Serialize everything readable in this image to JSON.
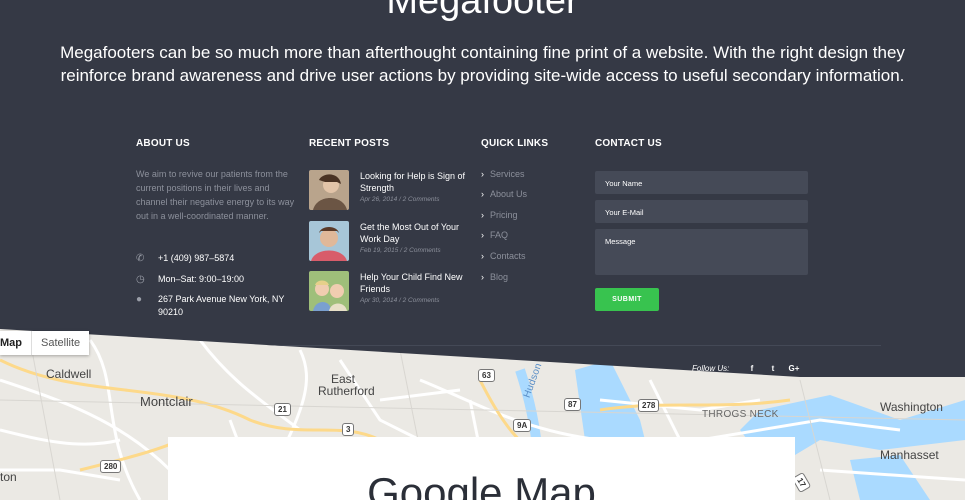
{
  "hero": {
    "title": "Megafooter",
    "description": "Megafooters can be so much more than afterthought containing fine print of a website. With the right design they reinforce brand awareness and drive user actions by providing site-wide access to useful secondary information."
  },
  "about": {
    "heading": "ABOUT US",
    "text": "We aim to revive our patients from the current positions in their lives and channel their negative energy to its way out in a well-coordinated manner.",
    "phone": "+1 (409) 987–5874",
    "hours": "Mon–Sat: 9:00–19:00",
    "address": "267 Park Avenue New York, NY 90210"
  },
  "recent_posts": {
    "heading": "RECENT POSTS",
    "items": [
      {
        "title": "Looking for Help is Sign of Strength",
        "meta": "Apr 26, 2014 / 2 Comments"
      },
      {
        "title": "Get the Most Out of Your Work Day",
        "meta": "Feb 19, 2015 / 2 Comments"
      },
      {
        "title": "Help Your Child Find New Friends",
        "meta": "Apr 30, 2014 / 2 Comments"
      }
    ]
  },
  "quick_links": {
    "heading": "QUICK LINKS",
    "items": [
      "Services",
      "About Us",
      "Pricing",
      "FAQ",
      "Contacts",
      "Blog"
    ]
  },
  "contact": {
    "heading": "CONTACT US",
    "name_placeholder": "Your Name",
    "email_placeholder": "Your E-Mail",
    "message_placeholder": "Message",
    "submit_label": "SUBMIT"
  },
  "social": {
    "follow_label": "Follow Us:",
    "icons": [
      "f",
      "t",
      "G+"
    ]
  },
  "map": {
    "type_options": [
      "Map",
      "Satellite"
    ],
    "selected_type": "Map",
    "places": [
      "Caldwell",
      "East Rutherford",
      "Montclair",
      "Washington",
      "Manhasset",
      "THROGS NECK",
      "Hudson"
    ],
    "partial_place": "ton",
    "shields": [
      "63",
      "87",
      "278",
      "21",
      "3",
      "9A",
      "280",
      "17"
    ],
    "section_title": "Google Map"
  },
  "colors": {
    "footer_bg": "#353945",
    "input_bg": "#454a57",
    "submit_bg": "#38c34f",
    "muted_text": "#8c909b",
    "map_water": "#aadaff"
  }
}
